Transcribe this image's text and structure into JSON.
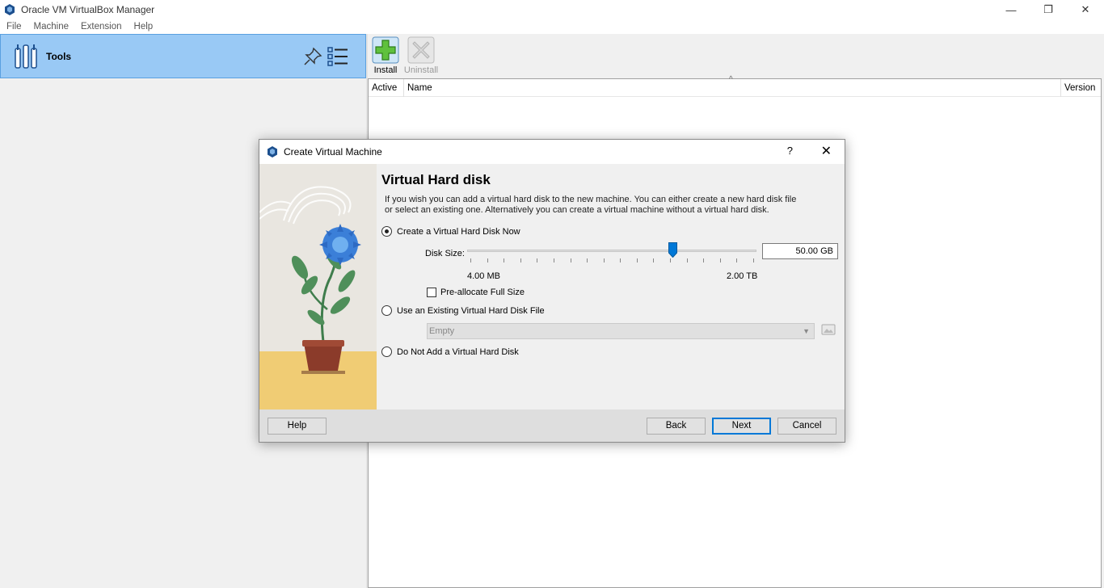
{
  "window": {
    "title": "Oracle VM VirtualBox Manager"
  },
  "menubar": {
    "items": [
      "File",
      "Machine",
      "Extension",
      "Help"
    ]
  },
  "tools": {
    "label": "Tools"
  },
  "toolbar": {
    "install_label": "Install",
    "uninstall_label": "Uninstall"
  },
  "table": {
    "columns": [
      "Active",
      "Name",
      "Version"
    ]
  },
  "dialog": {
    "title": "Create Virtual Machine",
    "help_glyph": "?",
    "page_title": "Virtual Hard disk",
    "description": "If you wish you can add a virtual hard disk to the new machine. You can either create a new hard disk file or select an existing one. Alternatively you can create a virtual machine without a virtual hard disk.",
    "options": {
      "create_now": "Create a Virtual Hard Disk Now",
      "use_existing": "Use an Existing Virtual Hard Disk File",
      "do_not_add": "Do Not Add a Virtual Hard Disk"
    },
    "selected_option": "create_now",
    "disk_size_label": "Disk Size:",
    "disk_size_value": "50.00 GB",
    "slider": {
      "min_label": "4.00 MB",
      "max_label": "2.00 TB",
      "position_fraction": 0.71
    },
    "preallocate_label": "Pre-allocate Full Size",
    "preallocate_checked": false,
    "existing_combo_value": "Empty",
    "buttons": {
      "help": "Help",
      "back": "Back",
      "next": "Next",
      "cancel": "Cancel"
    }
  },
  "colors": {
    "accent": "#0078d7",
    "selection": "#99c9f5"
  }
}
